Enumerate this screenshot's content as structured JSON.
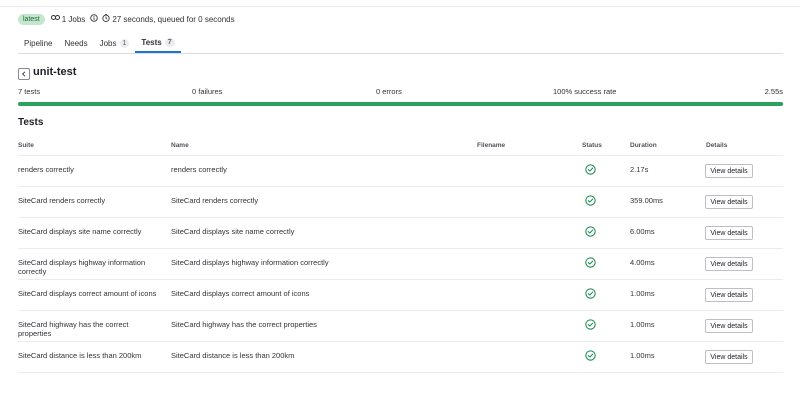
{
  "header": {
    "badge": "latest",
    "jobs": "1 Jobs",
    "timing": "27 seconds, queued for 0 seconds"
  },
  "tabs": [
    {
      "label": "Pipeline",
      "count": null
    },
    {
      "label": "Needs",
      "count": null
    },
    {
      "label": "Jobs",
      "count": "1"
    },
    {
      "label": "Tests",
      "count": "7",
      "active": true
    }
  ],
  "suite": {
    "title": "unit-test",
    "summary": {
      "tests": "7 tests",
      "failures": "0 failures",
      "errors": "0 errors",
      "success_rate": "100% success rate",
      "duration": "2.55s"
    },
    "progress_fraction": 1.0
  },
  "tests_heading": "Tests",
  "columns": {
    "suite": "Suite",
    "name": "Name",
    "filename": "Filename",
    "status": "Status",
    "duration": "Duration",
    "details": "Details"
  },
  "rows": [
    {
      "suite": "renders correctly",
      "name": "renders correctly",
      "filename": "",
      "status": "success",
      "duration": "2.17s",
      "action": "View details"
    },
    {
      "suite": "SiteCard renders correctly",
      "name": "SiteCard renders correctly",
      "filename": "",
      "status": "success",
      "duration": "359.00ms",
      "action": "View details"
    },
    {
      "suite": "SiteCard displays site name correctly",
      "name": "SiteCard displays site name correctly",
      "filename": "",
      "status": "success",
      "duration": "6.00ms",
      "action": "View details"
    },
    {
      "suite": "SiteCard displays highway information correctly",
      "name": "SiteCard displays highway information correctly",
      "filename": "",
      "status": "success",
      "duration": "4.00ms",
      "action": "View details"
    },
    {
      "suite": "SiteCard displays correct amount of icons",
      "name": "SiteCard displays correct amount of icons",
      "filename": "",
      "status": "success",
      "duration": "1.00ms",
      "action": "View details"
    },
    {
      "suite": "SiteCard highway has the correct properties",
      "name": "SiteCard highway has the correct properties",
      "filename": "",
      "status": "success",
      "duration": "1.00ms",
      "action": "View details"
    },
    {
      "suite": "SiteCard distance is less than 200km",
      "name": "SiteCard distance is less than 200km",
      "filename": "",
      "status": "success",
      "duration": "1.00ms",
      "action": "View details"
    }
  ],
  "colors": {
    "success": "#108548",
    "progress": "#2da160",
    "active_tab": "#1f75cb"
  },
  "icons": {
    "jobs": "jobs-icon",
    "info": "info-icon",
    "clock": "clock-icon",
    "back": "chevron-left-icon",
    "status": "status-success-icon"
  }
}
